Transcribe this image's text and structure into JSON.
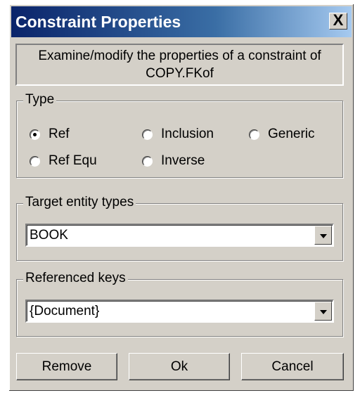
{
  "window": {
    "title": "Constraint Properties",
    "close_label": "X"
  },
  "description": {
    "line1": "Examine/modify the properties of a constraint of",
    "line2": "COPY.FKof"
  },
  "type_group": {
    "legend": "Type",
    "options": [
      {
        "label": "Ref",
        "selected": true
      },
      {
        "label": "Inclusion",
        "selected": false
      },
      {
        "label": "Generic",
        "selected": false
      },
      {
        "label": "Ref Equ",
        "selected": false
      },
      {
        "label": "Inverse",
        "selected": false
      }
    ]
  },
  "target_group": {
    "legend": "Target entity types",
    "value": "BOOK"
  },
  "keys_group": {
    "legend": "Referenced keys",
    "value": "{Document}"
  },
  "buttons": {
    "remove": "Remove",
    "ok": "Ok",
    "cancel": "Cancel"
  }
}
